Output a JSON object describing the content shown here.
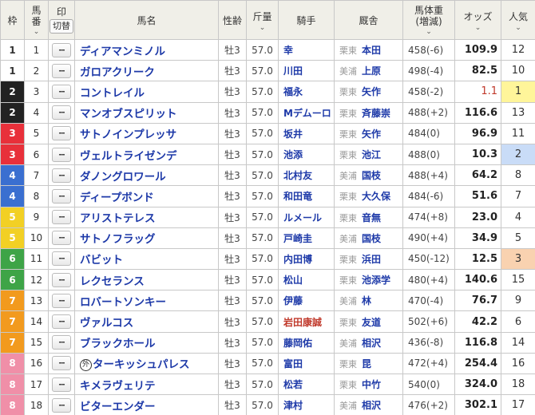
{
  "headers": {
    "waku": "枠",
    "umaban_1": "馬",
    "umaban_2": "番",
    "mark": "印",
    "mark_toggle": "切替",
    "horse_name": "馬名",
    "age": "性齢",
    "weight": "斤量",
    "jockey": "騎手",
    "stable": "厩舎",
    "body_weight_1": "馬体重",
    "body_weight_2": "(増減)",
    "odds": "オッズ",
    "popularity": "人気"
  },
  "mark_default": "--",
  "waku_colors": {
    "1": {
      "bg": "#ffffff",
      "fg": "#333333"
    },
    "2": {
      "bg": "#222222",
      "fg": "#ffffff"
    },
    "3": {
      "bg": "#e8303a",
      "fg": "#ffffff"
    },
    "4": {
      "bg": "#3a6fd0",
      "fg": "#ffffff"
    },
    "5": {
      "bg": "#f2d024",
      "fg": "#ffffff"
    },
    "6": {
      "bg": "#3ea447",
      "fg": "#ffffff"
    },
    "7": {
      "bg": "#f29a1e",
      "fg": "#ffffff"
    },
    "8": {
      "bg": "#f08fa8",
      "fg": "#ffffff"
    }
  },
  "popularity_highlights": {
    "1": "#fff59a",
    "2": "#c9dcf7",
    "3": "#f9d2b0"
  },
  "rows": [
    {
      "waku": "1",
      "umaban": "1",
      "name": "ディアマンミノル",
      "age": "牡3",
      "weight": "57.0",
      "jockey": "幸",
      "region": "栗東",
      "trainer": "本田",
      "body_weight": "458(-6)",
      "odds": "109.9",
      "rank": "12"
    },
    {
      "waku": "1",
      "umaban": "2",
      "name": "ガロアクリーク",
      "age": "牡3",
      "weight": "57.0",
      "jockey": "川田",
      "region": "美浦",
      "trainer": "上原",
      "body_weight": "498(-4)",
      "odds": "82.5",
      "rank": "10"
    },
    {
      "waku": "2",
      "umaban": "3",
      "name": "コントレイル",
      "age": "牡3",
      "weight": "57.0",
      "jockey": "福永",
      "region": "栗東",
      "trainer": "矢作",
      "body_weight": "458(-2)",
      "odds": "1.1",
      "rank": "1"
    },
    {
      "waku": "2",
      "umaban": "4",
      "name": "マンオブスピリット",
      "age": "牡3",
      "weight": "57.0",
      "jockey": "Mデムーロ",
      "region": "栗東",
      "trainer": "斉藤崇",
      "body_weight": "488(+2)",
      "odds": "116.6",
      "rank": "13"
    },
    {
      "waku": "3",
      "umaban": "5",
      "name": "サトノインプレッサ",
      "age": "牡3",
      "weight": "57.0",
      "jockey": "坂井",
      "region": "栗東",
      "trainer": "矢作",
      "body_weight": "484(0)",
      "odds": "96.9",
      "rank": "11"
    },
    {
      "waku": "3",
      "umaban": "6",
      "name": "ヴェルトライゼンデ",
      "age": "牡3",
      "weight": "57.0",
      "jockey": "池添",
      "region": "栗東",
      "trainer": "池江",
      "body_weight": "488(0)",
      "odds": "10.3",
      "rank": "2"
    },
    {
      "waku": "4",
      "umaban": "7",
      "name": "ダノングロワール",
      "age": "牡3",
      "weight": "57.0",
      "jockey": "北村友",
      "region": "美浦",
      "trainer": "国枝",
      "body_weight": "488(+4)",
      "odds": "64.2",
      "rank": "8"
    },
    {
      "waku": "4",
      "umaban": "8",
      "name": "ディープボンド",
      "age": "牡3",
      "weight": "57.0",
      "jockey": "和田竜",
      "region": "栗東",
      "trainer": "大久保",
      "body_weight": "484(-6)",
      "odds": "51.6",
      "rank": "7"
    },
    {
      "waku": "5",
      "umaban": "9",
      "name": "アリストテレス",
      "age": "牡3",
      "weight": "57.0",
      "jockey": "ルメール",
      "region": "栗東",
      "trainer": "音無",
      "body_weight": "474(+8)",
      "odds": "23.0",
      "rank": "4"
    },
    {
      "waku": "5",
      "umaban": "10",
      "name": "サトノフラッグ",
      "age": "牡3",
      "weight": "57.0",
      "jockey": "戸崎圭",
      "region": "美浦",
      "trainer": "国枝",
      "body_weight": "490(+4)",
      "odds": "34.9",
      "rank": "5"
    },
    {
      "waku": "6",
      "umaban": "11",
      "name": "バビット",
      "age": "牡3",
      "weight": "57.0",
      "jockey": "内田博",
      "region": "栗東",
      "trainer": "浜田",
      "body_weight": "450(-12)",
      "odds": "12.5",
      "rank": "3"
    },
    {
      "waku": "6",
      "umaban": "12",
      "name": "レクセランス",
      "age": "牡3",
      "weight": "57.0",
      "jockey": "松山",
      "region": "栗東",
      "trainer": "池添学",
      "body_weight": "480(+4)",
      "odds": "140.6",
      "rank": "15"
    },
    {
      "waku": "7",
      "umaban": "13",
      "name": "ロバートソンキー",
      "age": "牡3",
      "weight": "57.0",
      "jockey": "伊藤",
      "region": "美浦",
      "trainer": "林",
      "body_weight": "470(-4)",
      "odds": "76.7",
      "rank": "9"
    },
    {
      "waku": "7",
      "umaban": "14",
      "name": "ヴァルコス",
      "age": "牡3",
      "weight": "57.0",
      "jockey": "岩田康誠",
      "jockey_red": true,
      "region": "栗東",
      "trainer": "友道",
      "body_weight": "502(+6)",
      "odds": "42.2",
      "rank": "6"
    },
    {
      "waku": "7",
      "umaban": "15",
      "name": "ブラックホール",
      "age": "牡3",
      "weight": "57.0",
      "jockey": "藤岡佑",
      "region": "美浦",
      "trainer": "相沢",
      "body_weight": "436(-8)",
      "odds": "116.8",
      "rank": "14"
    },
    {
      "waku": "8",
      "umaban": "16",
      "name": "ターキッシュパレス",
      "foreign": true,
      "foreign_mark": "外",
      "age": "牡3",
      "weight": "57.0",
      "jockey": "富田",
      "region": "栗東",
      "trainer": "昆",
      "body_weight": "472(+4)",
      "odds": "254.4",
      "rank": "16"
    },
    {
      "waku": "8",
      "umaban": "17",
      "name": "キメラヴェリテ",
      "age": "牡3",
      "weight": "57.0",
      "jockey": "松若",
      "region": "栗東",
      "trainer": "中竹",
      "body_weight": "540(0)",
      "odds": "324.0",
      "rank": "18"
    },
    {
      "waku": "8",
      "umaban": "18",
      "name": "ビターエンダー",
      "age": "牡3",
      "weight": "57.0",
      "jockey": "津村",
      "region": "美浦",
      "trainer": "相沢",
      "body_weight": "476(+2)",
      "odds": "302.1",
      "rank": "17"
    }
  ]
}
